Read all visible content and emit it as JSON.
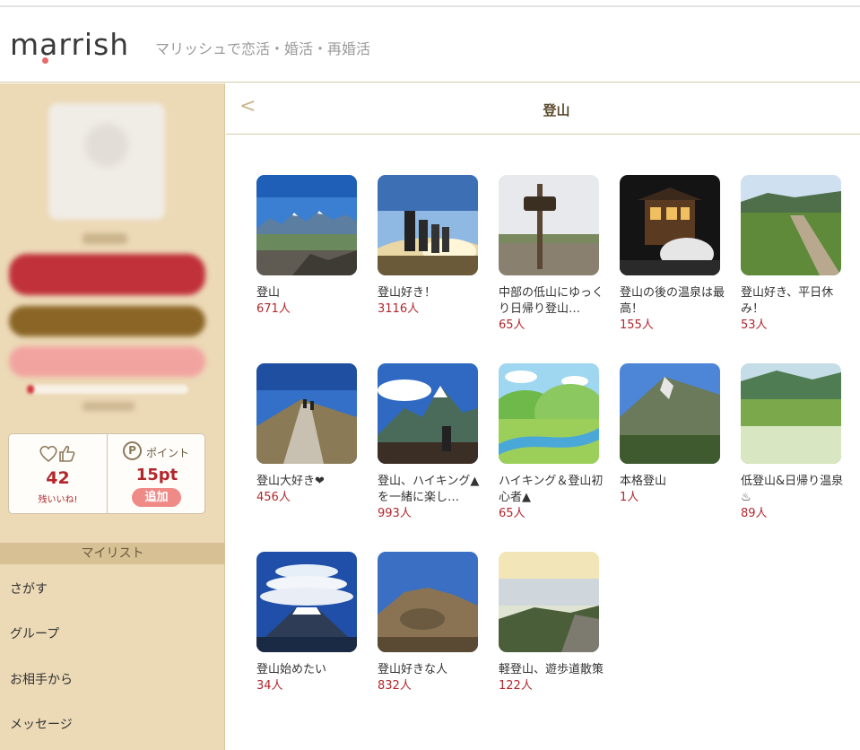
{
  "header": {
    "logo": "marrish",
    "tagline": "マリッシュで恋活・婚活・再婚活"
  },
  "sidebar": {
    "likes_count": "42",
    "likes_label": "残いいね!",
    "points_label": "ポイント",
    "points_value": "15pt",
    "add_label": "追加",
    "mylist_label": "マイリスト",
    "nav": [
      "さがす",
      "グループ",
      "お相手から",
      "メッセージ"
    ]
  },
  "main": {
    "title": "登山",
    "back_icon": "chevron-left-icon"
  },
  "groups": [
    {
      "name": "登山",
      "count": "671人"
    },
    {
      "name": "登山好き！",
      "count": "3116人"
    },
    {
      "name": "中部の低山にゆっくり日帰り登山…",
      "count": "65人"
    },
    {
      "name": "登山の後の温泉は最高！",
      "count": "155人"
    },
    {
      "name": "登山好き、平日休み！",
      "count": "53人"
    },
    {
      "name": "登山大好き❤",
      "count": "456人"
    },
    {
      "name": "登山、ハイキング▲を一緒に楽し…",
      "count": "993人"
    },
    {
      "name": "ハイキング＆登山初心者▲",
      "count": "65人"
    },
    {
      "name": "本格登山",
      "count": "1人"
    },
    {
      "name": "低登山&日帰り温泉♨",
      "count": "89人"
    },
    {
      "name": "登山始めたい",
      "count": "34人"
    },
    {
      "name": "登山好きな人",
      "count": "832人"
    },
    {
      "name": "軽登山、遊歩道散策",
      "count": "122人"
    }
  ],
  "colors": {
    "accent_red": "#b2272d",
    "sidebar_bg": "#ecd9b6",
    "gold": "#8a6526"
  }
}
